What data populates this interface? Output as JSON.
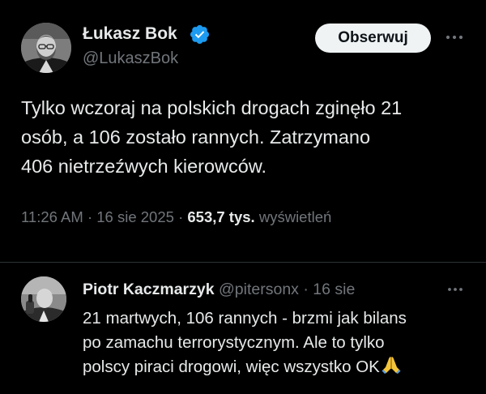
{
  "main_tweet": {
    "author_name": "Łukasz Bok",
    "author_handle": "@LukaszBok",
    "follow_label": "Obserwuj",
    "text_lines": [
      "Tylko wczoraj na polskich drogach zginęło 21",
      "osób, a 106 zostało rannych. Zatrzymano",
      "406 nietrzeźwych kierowców."
    ],
    "time": "11:26 AM",
    "date": "16 sie 2025",
    "views_count": "653,7 tys.",
    "views_label": "wyświetleń",
    "separator": "·",
    "icons": {
      "verified": "verified-badge-icon",
      "more": "more-options-icon"
    },
    "colors": {
      "verified": "#1d9bf0",
      "secondary_text": "#71767b",
      "primary_text": "#e7e9ea",
      "follow_bg": "#eff3f4"
    }
  },
  "reply": {
    "author_name": "Piotr Kaczmarzyk",
    "author_handle": "@pitersonx",
    "date": "16 sie",
    "separator": "·",
    "text_lines": [
      "21 martwych, 106 rannych - brzmi jak bilans",
      "po zamachu terrorystycznym. Ale to tylko",
      "polscy piraci drogowi, więc wszystko OK"
    ],
    "emoji": "folded-hands-emoji",
    "icons": {
      "more": "more-options-icon"
    }
  }
}
